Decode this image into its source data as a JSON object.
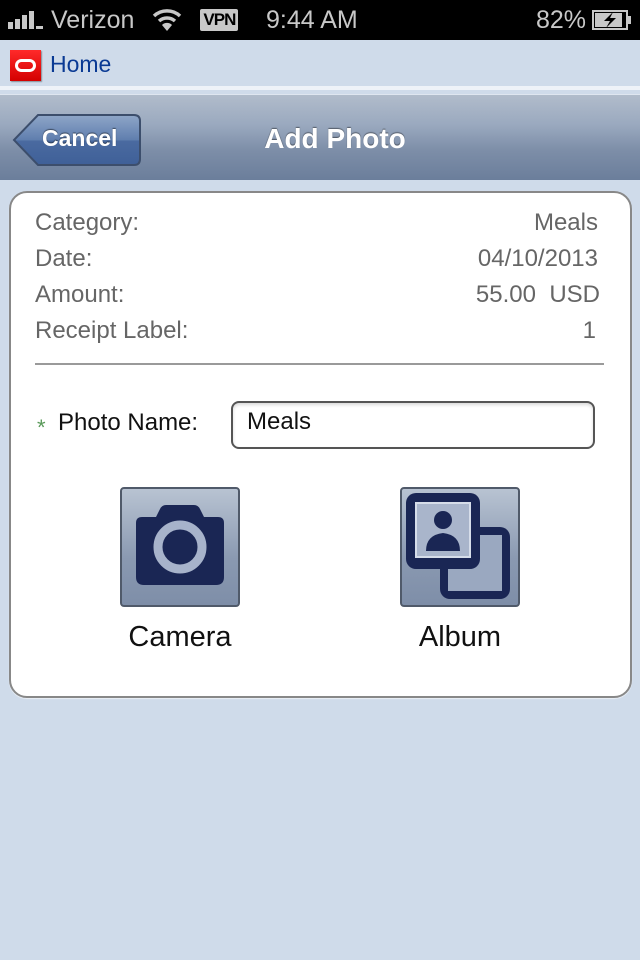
{
  "status_bar": {
    "carrier": "Verizon",
    "vpn": "VPN",
    "time": "9:44 AM",
    "battery": "82%",
    "icons": [
      "signal-icon",
      "wifi-icon",
      "vpn-badge",
      "battery-charging-icon"
    ]
  },
  "home_bar": {
    "logo": "oracle-logo",
    "home_label": "Home"
  },
  "nav": {
    "back_label": "Cancel",
    "title": "Add Photo"
  },
  "details": [
    {
      "label": "Category:",
      "value": "Meals"
    },
    {
      "label": "Date:",
      "value": "04/10/2013"
    },
    {
      "label": "Amount:",
      "value": "55.00  USD"
    },
    {
      "label": "Receipt Label:",
      "value": "1"
    }
  ],
  "photo_name": {
    "required_marker": "*",
    "label": "Photo Name:",
    "value": "Meals"
  },
  "actions": [
    {
      "label": "Camera",
      "icon": "camera-icon"
    },
    {
      "label": "Album",
      "icon": "album-icon"
    }
  ],
  "colors": {
    "background": "#cfdbea",
    "link": "#0a3a94",
    "icon_fill": "#1a2654",
    "required": "#5a9a5a",
    "brand_red": "#e00000"
  }
}
